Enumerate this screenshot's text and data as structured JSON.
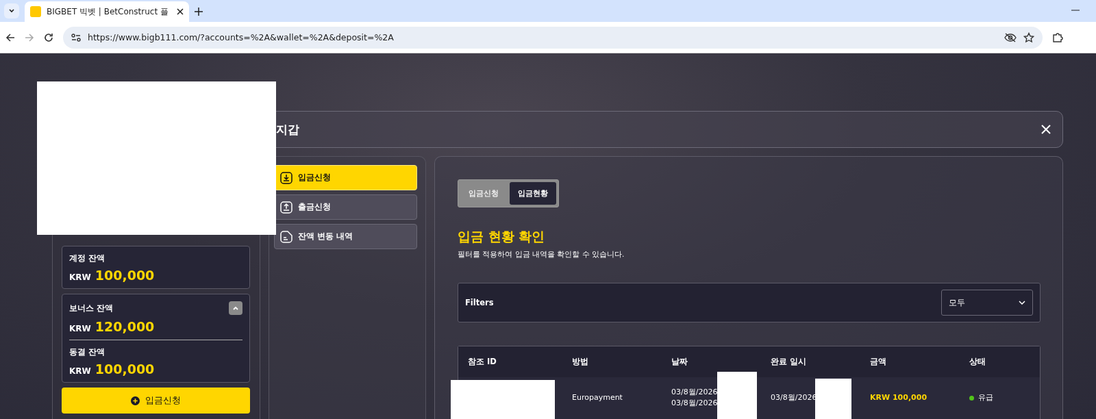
{
  "browser": {
    "tab_title": "BIGBET 빅벳 | BetConstruct 플",
    "url": "https://www.bigb111.com/?accounts=%2A&wallet=%2A&deposit=%2A"
  },
  "wallet": {
    "title": "지갑",
    "account_balance": {
      "label": "계정 잔액",
      "currency": "KRW",
      "amount": "100,000"
    },
    "bonus_balance": {
      "label": "보너스 잔액",
      "currency": "KRW",
      "amount": "120,000",
      "expanded": true
    },
    "frozen_balance": {
      "label": "동결 잔액",
      "currency": "KRW",
      "amount": "100,000"
    },
    "deposit_button": "입금신청",
    "menu": [
      {
        "label": "입금신청",
        "selected": true
      },
      {
        "label": "출금신청",
        "selected": false
      },
      {
        "label": "잔액 변동 내역",
        "selected": false
      }
    ],
    "segments": [
      {
        "label": "입금신청",
        "selected": false
      },
      {
        "label": "입금현황",
        "selected": true
      }
    ],
    "heading": "입금 현황 확인",
    "subtitle": "필터를 적용하여 입금 내역을 확인할 수 있습니다.",
    "filters": {
      "label": "Filters",
      "value": "모두"
    },
    "table": {
      "columns": [
        "참조 ID",
        "방법",
        "날짜",
        "완료 일시",
        "금액",
        "상태"
      ],
      "rows": [
        {
          "method": "Europayment",
          "dates": [
            "03/8월/2026",
            "03/8월/2026"
          ],
          "completed": "03/8월/2026",
          "amount": "KRW 100,000",
          "status": "유급",
          "color": "#52c41a"
        }
      ]
    }
  }
}
